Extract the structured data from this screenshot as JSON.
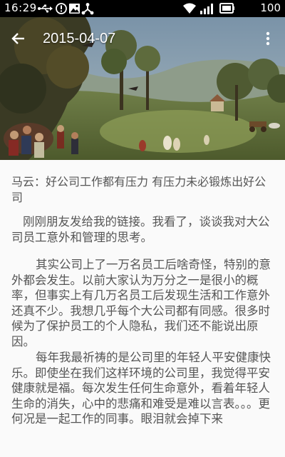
{
  "status_bar": {
    "time": "16:29",
    "battery_level": "100",
    "icons": [
      "usb-icon",
      "alert-icon",
      "image-icon",
      "share-icon",
      "wifi-icon",
      "signal-icon",
      "battery-icon"
    ]
  },
  "toolbar": {
    "title": "2015-04-07",
    "back_icon": "arrow-back-icon",
    "more_icon": "more-vertical-icon"
  },
  "article": {
    "title": "马云：好公司工作都有压力 有压力未必锻炼出好公司",
    "paragraphs": [
      "刚刚朋友发给我的链接。我看了，谈谈我对大公司员工意外和管理的思考。",
      "其实公司上了一万名员工后啥奇怪，特别的意外都会发生。以前大家认为万分之一是很小的概率，但事实上有几万名员工后发现生活和工作意外还真不少。我想几乎每个大公司都有同感。很多时候为了保护员工的个人隐私，我们还不能说出原因。",
      "每年我最祈祷的是公司里的年轻人平安健康快乐。即使坐在我们这样环境的公司里，我觉得平安健康就是福。每次发生任何生命意外，看着年轻人生命的消失，心中的悲痛和难受是难以言表。。。更何况是一起工作的同事。眼泪就会掉下来"
    ]
  },
  "colors": {
    "status_bar": "#000000",
    "background": "#fafafa",
    "text": "#555555",
    "toolbar_text": "#ffffff"
  }
}
